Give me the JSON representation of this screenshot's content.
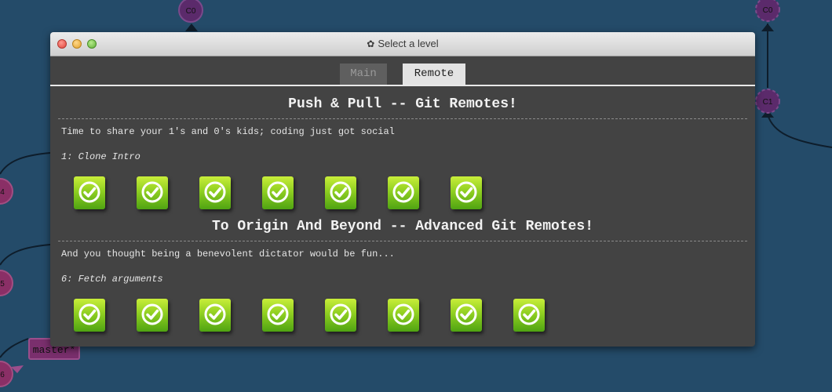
{
  "background": {
    "nodes": [
      "C0",
      "C0",
      "C1",
      "4",
      "5",
      "6"
    ],
    "branch_tag": "master*",
    "colors": {
      "canvas": "#244b69",
      "node": "#5b2a6b",
      "node_pink": "#8a2f66",
      "edge": "#0e1d2b"
    }
  },
  "window": {
    "title": "Select a level",
    "title_icon": "gear-icon"
  },
  "tabs": [
    {
      "label": "Main",
      "active": false
    },
    {
      "label": "Remote",
      "active": true
    }
  ],
  "sections": [
    {
      "title": "Push & Pull -- Git Remotes!",
      "description": "Time to share your 1's and 0's kids; coding just got social",
      "level_label": "1: Clone Intro",
      "levels_completed": [
        true,
        true,
        true,
        true,
        true,
        true,
        true
      ]
    },
    {
      "title": "To Origin And Beyond -- Advanced Git Remotes!",
      "description": "And you thought being a benevolent dictator would be fun...",
      "level_label": "6: Fetch arguments",
      "levels_completed": [
        true,
        true,
        true,
        true,
        true,
        true,
        true,
        true
      ]
    }
  ],
  "colors": {
    "window_bg": "#434343",
    "level_green": "#7cc41f",
    "tab_active": "#e3e3e3",
    "tab_inactive": "#5f5f5f"
  }
}
